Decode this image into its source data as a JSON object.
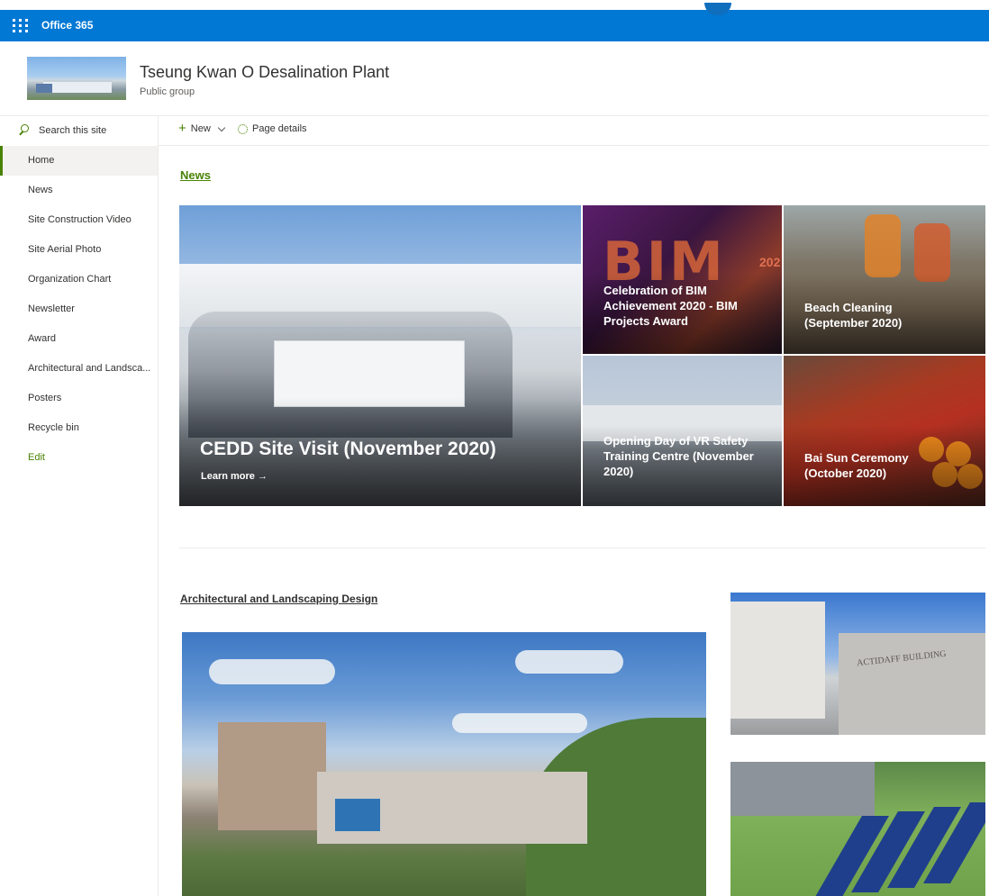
{
  "suite": {
    "title": "Office 365"
  },
  "site": {
    "title": "Tseung Kwan O Desalination Plant",
    "subtitle": "Public group"
  },
  "search": {
    "placeholder": "Search this site"
  },
  "nav": {
    "items": [
      {
        "label": "Home",
        "active": true
      },
      {
        "label": "News"
      },
      {
        "label": "Site Construction Video"
      },
      {
        "label": "Site Aerial Photo"
      },
      {
        "label": "Organization Chart"
      },
      {
        "label": "Newsletter"
      },
      {
        "label": "Award"
      },
      {
        "label": "Architectural and Landsca..."
      },
      {
        "label": "Posters"
      },
      {
        "label": "Recycle bin"
      }
    ],
    "edit_label": "Edit"
  },
  "commandbar": {
    "new_label": "New",
    "page_details_label": "Page details"
  },
  "news": {
    "heading": "News",
    "hero": {
      "title": "CEDD Site Visit (November 2020)",
      "link": "Learn more →"
    },
    "tiles": [
      {
        "title": "Celebration of BIM Achievement 2020 - BIM Projects Award"
      },
      {
        "title": "Beach Cleaning (September 2020)"
      },
      {
        "title": "Opening Day of VR Safety Training Centre (November 2020)"
      },
      {
        "title": "Bai Sun Ceremony (October 2020)"
      }
    ]
  },
  "architecture": {
    "heading": "Architectural and Landscaping Design",
    "building_sign": "ACTIDAFF BUILDING"
  },
  "colors": {
    "suitebar": "#0078d4",
    "accent": "#498205"
  }
}
